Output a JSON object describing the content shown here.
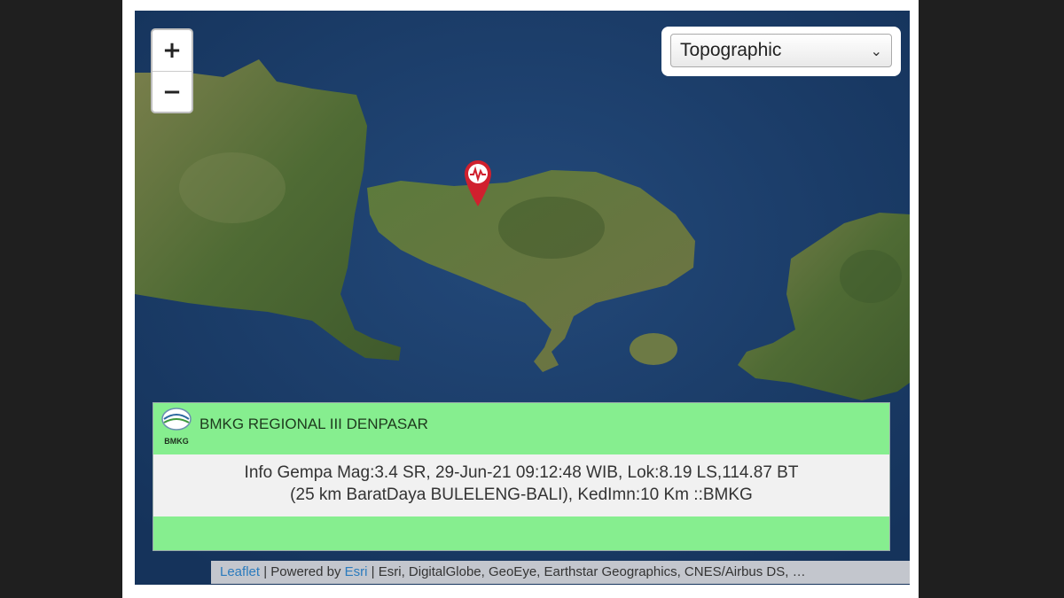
{
  "map": {
    "zoom_in_label": "+",
    "zoom_out_label": "−",
    "layer_select": {
      "selected": "Topographic",
      "options": [
        "Topographic"
      ]
    },
    "marker_icon": "earthquake-marker-icon",
    "attribution": {
      "leaflet_link": "Leaflet",
      "separator1": " | Powered by ",
      "esri_link": "Esri",
      "credits": " | Esri, DigitalGlobe, GeoEye, Earthstar Geographics, CNES/Airbus DS, …"
    }
  },
  "info_panel": {
    "logo_text": "BMKG",
    "header": "BMKG REGIONAL III DENPASAR",
    "line1": "Info Gempa Mag:3.4 SR, 29-Jun-21 09:12:48 WIB, Lok:8.19 LS,114.87 BT",
    "line2": "(25 km BaratDaya BULELENG-BALI), KedImn:10 Km ::BMKG"
  },
  "colors": {
    "ocean": "#1d3f6c",
    "land": "#4d6b36",
    "panel_green": "#86ee8f",
    "marker_red": "#d0202e"
  }
}
